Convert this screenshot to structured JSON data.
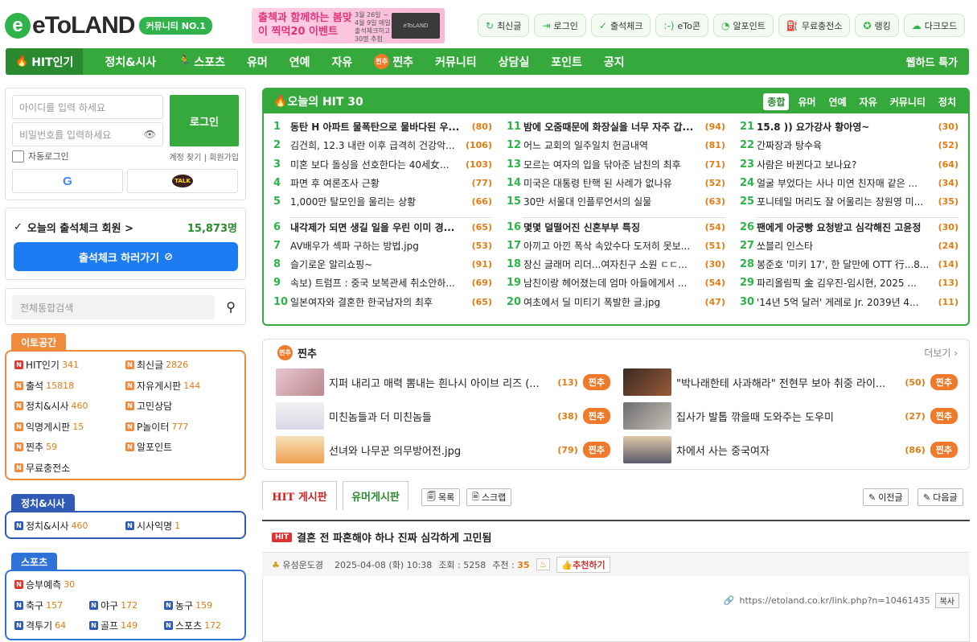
{
  "header": {
    "logo_letter": "e",
    "logo_text": "eToLAND",
    "logo_badge": "커뮤니티 NO.1",
    "banner_main": "출첵과 함께하는 봄맞이 찍먹20 이벤트",
    "banner_sub": "3월 26일 ~ 4월 9일 매일 출석체크하고 30명 추첨",
    "banner_brand": "eToLAND",
    "quick": [
      {
        "icon": "refresh-icon",
        "glyph": "↻",
        "label": "최신글"
      },
      {
        "icon": "login-icon",
        "glyph": "⇥",
        "label": "로그인"
      },
      {
        "icon": "check-icon",
        "glyph": "✓",
        "label": "출석체크"
      },
      {
        "icon": "smile-icon",
        "glyph": ":-)",
        "label": "eTo콘"
      },
      {
        "icon": "point-icon",
        "glyph": "◔",
        "label": "알포인트"
      },
      {
        "icon": "charge-icon",
        "glyph": "⛽",
        "label": "무료충전소"
      },
      {
        "icon": "star-icon",
        "glyph": "✪",
        "label": "랭킹"
      },
      {
        "icon": "dark-mode-icon",
        "glyph": "☁",
        "label": "다크모드"
      }
    ]
  },
  "nav": {
    "items": [
      "HIT인기",
      "정치&시사",
      "스포츠",
      "유머",
      "연예",
      "자유",
      "찐추",
      "커뮤니티",
      "상담실",
      "포인트",
      "공지"
    ],
    "chu_badge": "찐추",
    "right": "웹하드 특가"
  },
  "login": {
    "id_placeholder": "아이디를 입력 하세요",
    "pw_placeholder": "비밀번호를 입력하세요",
    "button": "로그인",
    "auto_login": "자동로그인",
    "find_account": "계정 찾기",
    "signup": "회원가입",
    "google": "G",
    "kakao": "TALK"
  },
  "attendance": {
    "title": "오늘의 출석체크 회원 >",
    "count": "15,873명",
    "button": "출석체크 하러가기"
  },
  "search": {
    "placeholder": "전체통합검색"
  },
  "categories": [
    {
      "title": "이토공간",
      "items": [
        {
          "label": "HIT인기",
          "count": "341",
          "badge": "red"
        },
        {
          "label": "최신글",
          "count": "2826",
          "badge": "orange"
        },
        {
          "label": "출석",
          "count": "15818",
          "badge": "orange"
        },
        {
          "label": "자유게시판",
          "count": "144",
          "badge": "orange"
        },
        {
          "label": "정치&시사",
          "count": "460",
          "badge": "orange"
        },
        {
          "label": "고민상담",
          "count": "",
          "badge": "orange"
        },
        {
          "label": "익명게시판",
          "count": "15",
          "badge": "orange"
        },
        {
          "label": "P놀이터",
          "count": "777",
          "badge": "orange"
        },
        {
          "label": "찐추",
          "count": "59",
          "badge": "orange"
        },
        {
          "label": "알포인트",
          "count": "",
          "badge": "orange"
        },
        {
          "label": "무료충전소",
          "count": "",
          "badge": "orange"
        }
      ]
    },
    {
      "title": "정치&시사",
      "items": [
        {
          "label": "정치&시사",
          "count": "460",
          "badge": "blue"
        },
        {
          "label": "시사익명",
          "count": "1",
          "badge": "blue"
        }
      ]
    },
    {
      "title": "스포츠",
      "items": [
        {
          "label": "승부예측",
          "count": "30",
          "badge": "red"
        },
        {
          "label": "축구",
          "count": "157",
          "badge": "blue"
        },
        {
          "label": "야구",
          "count": "172",
          "badge": "blue"
        },
        {
          "label": "농구",
          "count": "159",
          "badge": "blue"
        },
        {
          "label": "격투기",
          "count": "64",
          "badge": "blue"
        },
        {
          "label": "골프",
          "count": "149",
          "badge": "blue"
        },
        {
          "label": "스포츠",
          "count": "172",
          "badge": "blue"
        }
      ]
    }
  ],
  "hit30": {
    "title": "오늘의 HIT 30",
    "tabs": [
      "종합",
      "유머",
      "연예",
      "자유",
      "커뮤니티",
      "정치"
    ],
    "items": [
      {
        "n": "1",
        "t": "동탄 H 아파트 물폭탄으로 물바다된 우...",
        "c": "(80)",
        "bold": true
      },
      {
        "n": "2",
        "t": "김건희, 12.3 내란 이후 급격히 건강악...",
        "c": "(106)"
      },
      {
        "n": "3",
        "t": "미혼 보다 돌싱을 선호한다는 40세女...",
        "c": "(103)"
      },
      {
        "n": "4",
        "t": "파면 후 여론조사 근황",
        "c": "(77)"
      },
      {
        "n": "5",
        "t": "1,000만 탈모인을 울리는 상황",
        "c": "(66)"
      },
      {
        "n": "6",
        "t": "내각제가 되면 생길 일을 우린 이미 경...",
        "c": "(65)",
        "bold": true
      },
      {
        "n": "7",
        "t": "AV배우가 섹파 구하는 방법.jpg",
        "c": "(53)"
      },
      {
        "n": "8",
        "t": "슬기로운 알리쇼핑~",
        "c": "(91)"
      },
      {
        "n": "9",
        "t": "속보) 트럼프 : 중국 보복관세 취소안하...",
        "c": "(69)"
      },
      {
        "n": "10",
        "t": "일본여자와 결혼한 한국남자의 최후",
        "c": "(65)"
      },
      {
        "n": "11",
        "t": "밤에 오줌때문에 화장실을 너무 자주 갑...",
        "c": "(94)",
        "bold": true
      },
      {
        "n": "12",
        "t": "어느 교회의 일주일치 헌금내역",
        "c": "(81)"
      },
      {
        "n": "13",
        "t": "모르는 여자의 입을 닦아준 남친의 최후",
        "c": "(71)"
      },
      {
        "n": "14",
        "t": "미국은 대통령 탄핵 된 사례가 없나유",
        "c": "(52)"
      },
      {
        "n": "15",
        "t": "30만 서울대 인플루언서의 실물",
        "c": "(63)"
      },
      {
        "n": "16",
        "t": "몇몇 덜떨어진 신혼부부 특징",
        "c": "(54)",
        "bold": true
      },
      {
        "n": "17",
        "t": "아끼고 아낀 폭삭 속았수다 도저히 못보...",
        "c": "(51)"
      },
      {
        "n": "18",
        "t": "장신 글래머 리더...여자친구 소원 ㄷㄷ...",
        "c": "(30)"
      },
      {
        "n": "19",
        "t": "남친이랑 헤어졌는데 엄마 아들에게서 ...",
        "c": "(54)"
      },
      {
        "n": "20",
        "t": "여초에서 딜 미티기 폭발한 글.jpg",
        "c": "(47)"
      },
      {
        "n": "21",
        "t": "15.8 )) 요가강사 황아영~",
        "c": "(30)",
        "bold": true
      },
      {
        "n": "22",
        "t": "간짜장과 탕수육",
        "c": "(52)"
      },
      {
        "n": "23",
        "t": "사람은 바뀐다고 보나요?",
        "c": "(64)"
      },
      {
        "n": "24",
        "t": "얼굴 부었다는 사나 미연 친자매 같은 ...",
        "c": "(34)"
      },
      {
        "n": "25",
        "t": "포니테일 머리도 잘 어울리는 장원영 미...",
        "c": "(35)"
      },
      {
        "n": "26",
        "t": "팬에게 아궁빵 요청받고 심각해진 고윤정",
        "c": "(30)",
        "bold": true
      },
      {
        "n": "27",
        "t": "쏘블리 인스타",
        "c": "(24)"
      },
      {
        "n": "28",
        "t": "봉준호 '미키 17', 한 달만에 OTT 行...8...",
        "c": "(14)"
      },
      {
        "n": "29",
        "t": "파리올림픽 金 김우진-임시현, 2025 ...",
        "c": "(13)"
      },
      {
        "n": "30",
        "t": "'14년 5억 달러' 게레로 Jr. 2039년 4...",
        "c": "(11)"
      }
    ]
  },
  "jjinchu": {
    "title": "찐추",
    "more": "더보기",
    "badge": "찐추",
    "items": [
      {
        "t": "지퍼 내리고 매력 뽐내는 흰나시 아이브 리즈 (...",
        "c": "(13)"
      },
      {
        "t": "\"박나래한테 사과해라\" 전현무 보아 취중 라이...",
        "c": "(50)"
      },
      {
        "t": "미친놈들과 더 미친놈들",
        "c": "(38)"
      },
      {
        "t": "집사가 발톱 깎을때 도와주는 도우미",
        "c": "(27)"
      },
      {
        "t": "선녀와 나무꾼 의무방어전.jpg",
        "c": "(79)"
      },
      {
        "t": "차에서 사는 중국여자",
        "c": "(86)"
      }
    ]
  },
  "board": {
    "tab_hit": "HIT 게시판",
    "tab_humor": "유머게시판",
    "list_btn": "목록",
    "scrap_btn": "스크랩",
    "prev_btn": "이전글",
    "next_btn": "다음글",
    "post_badge": "HIT",
    "post_title": "결혼 전 파혼해야 하나 진짜 심각하게 고민됨",
    "author": "유성운도경",
    "date": "2025-04-08 (화) 10:38",
    "views_label": "조회 :",
    "views": "5258",
    "rec_label": "추천 :",
    "rec": "35",
    "rec_btn": "추천하기",
    "link": "https://etoland.co.kr/link.php?n=10461435",
    "copy": "복사"
  }
}
